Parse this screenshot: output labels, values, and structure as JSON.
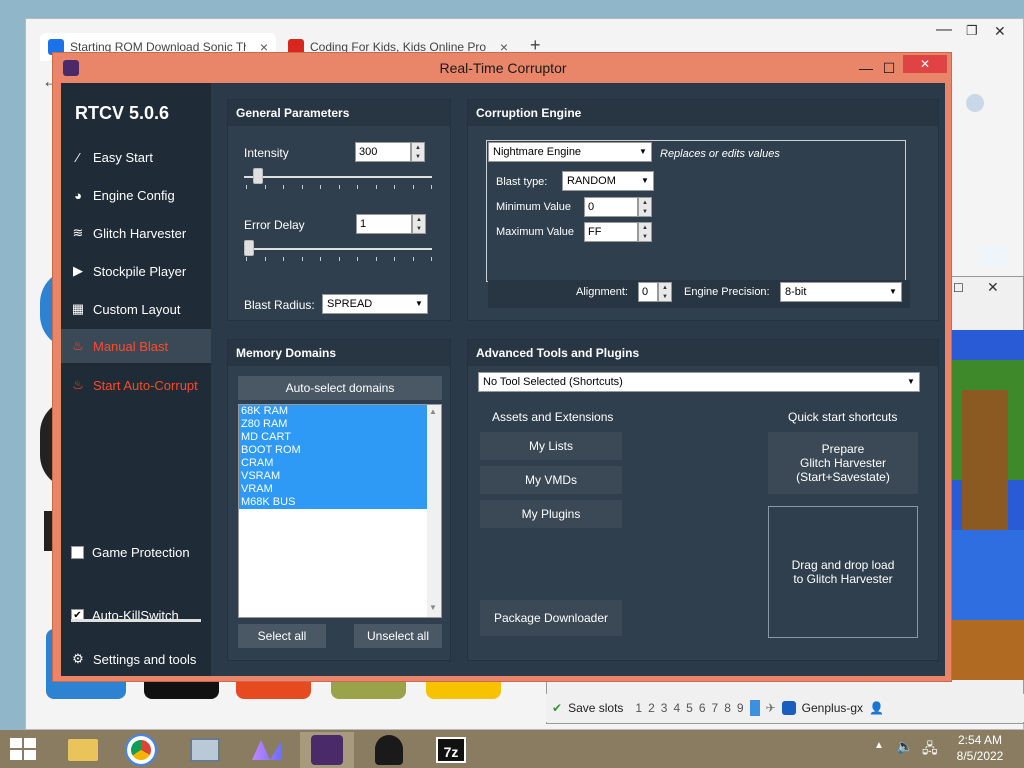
{
  "browser": {
    "tabs": [
      {
        "title": "Starting ROM Download Sonic Th",
        "close": "×"
      },
      {
        "title": "Coding For Kids, Kids Online Pro",
        "close": "×"
      }
    ],
    "new_tab": "+",
    "back": "←",
    "window_controls": {
      "minimize": "—",
      "restore": "❐",
      "close": "✕"
    }
  },
  "emulator": {
    "save_slots_label": "Save slots",
    "slots": [
      "1",
      "2",
      "3",
      "4",
      "5",
      "6",
      "7",
      "8",
      "9"
    ],
    "title": "Genplus-gx"
  },
  "rtc": {
    "window_title": "Real-Time Corruptor",
    "window_controls": {
      "minimize": "—",
      "maximize": "☐",
      "close": "✕"
    },
    "sidebar": {
      "title": "RTCV 5.0.6",
      "items": [
        {
          "label": "Easy Start",
          "icon": "wand-icon"
        },
        {
          "label": "Engine Config",
          "icon": "gauge-icon"
        },
        {
          "label": "Glitch Harvester",
          "icon": "layers-icon"
        },
        {
          "label": "Stockpile Player",
          "icon": "play-icon"
        },
        {
          "label": "Custom Layout",
          "icon": "grid-icon"
        },
        {
          "label": "Manual Blast",
          "icon": "fire-icon"
        },
        {
          "label": "Start Auto-Corrupt",
          "icon": "fire-icon"
        }
      ],
      "game_protection": "Game Protection",
      "auto_killswitch": "Auto-KillSwitch",
      "settings": "Settings and tools"
    },
    "general": {
      "title": "General Parameters",
      "intensity_label": "Intensity",
      "intensity_value": "300",
      "intensity_level": 0.05,
      "error_delay_label": "Error Delay",
      "error_delay_value": "1",
      "error_delay_level": 0.0,
      "blast_radius_label": "Blast Radius:",
      "blast_radius_value": "SPREAD"
    },
    "engine": {
      "title": "Corruption Engine",
      "engine_value": "Nightmare Engine",
      "engine_desc": "Replaces or edits values",
      "blast_type_label": "Blast type:",
      "blast_type_value": "RANDOM",
      "min_label": "Minimum Value",
      "min_value": "0",
      "max_label": "Maximum Value",
      "max_value": "FF",
      "alignment_label": "Alignment:",
      "alignment_value": "0",
      "precision_label": "Engine Precision:",
      "precision_value": "8-bit"
    },
    "memory": {
      "title": "Memory Domains",
      "auto_select": "Auto-select domains",
      "domains": [
        "68K RAM",
        "Z80 RAM",
        "MD CART",
        "BOOT ROM",
        "CRAM",
        "VSRAM",
        "VRAM",
        "M68K BUS"
      ],
      "select_all": "Select all",
      "unselect_all": "Unselect all"
    },
    "advanced": {
      "title": "Advanced Tools and Plugins",
      "tool_select": "No Tool Selected (Shortcuts)",
      "assets_title": "Assets and Extensions",
      "my_lists": "My Lists",
      "my_vmds": "My VMDs",
      "my_plugins": "My Plugins",
      "package_downloader": "Package Downloader",
      "quick_title": "Quick start shortcuts",
      "prepare_line1": "Prepare",
      "prepare_line2": "Glitch Harvester",
      "prepare_line3": "(Start+Savestate)",
      "drop_line1": "Drag and drop load",
      "drop_line2": "to Glitch Harvester"
    }
  },
  "taskbar": {
    "time": "2:54 AM",
    "date": "8/5/2022",
    "apps": [
      "file-explorer",
      "chrome",
      "control-panel",
      "corruptor-launcher",
      "rtcv",
      "anonymous",
      "7zip"
    ]
  }
}
